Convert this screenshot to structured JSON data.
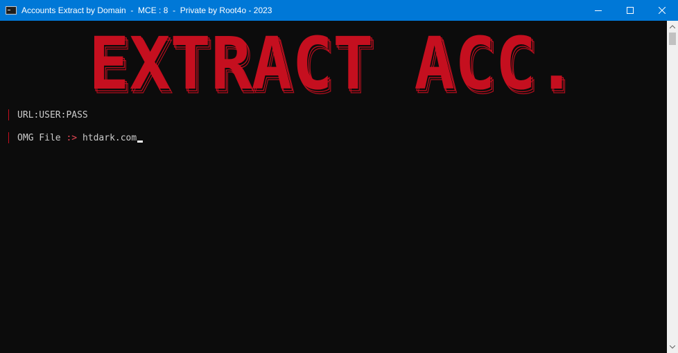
{
  "window": {
    "title": "Accounts Extract by Domain  -  MCE : 8  -  Private by Root4o - 2023",
    "controls": [
      "minimize-icon",
      "maximize-icon",
      "close-icon"
    ]
  },
  "banner": {
    "text": "EXTRACT ACC.",
    "color": "#c50f1f"
  },
  "console": {
    "lines": [
      {
        "text": "URL:USER:PASS"
      },
      {
        "label": "OMG File ",
        "prompt": ":>",
        "value": "htdark.com"
      }
    ]
  }
}
